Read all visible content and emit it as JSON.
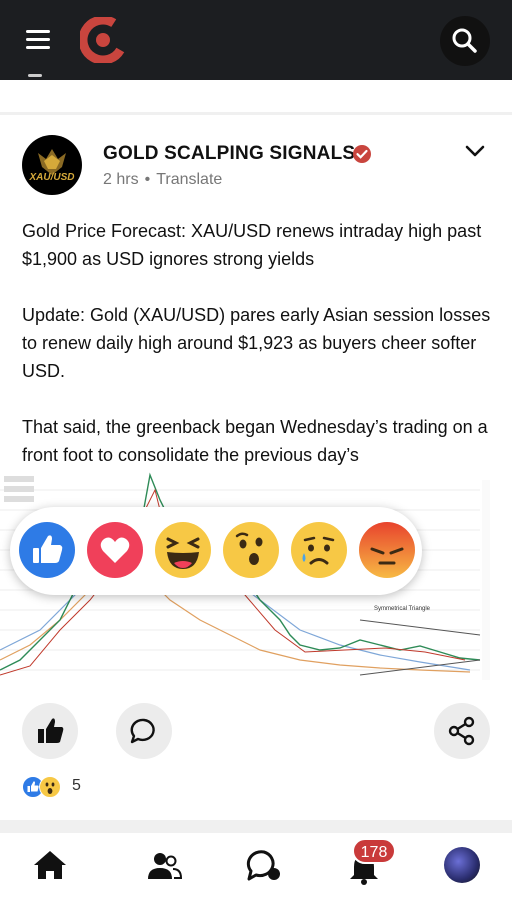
{
  "header": {
    "menu_icon": "hamburger-menu-icon",
    "logo_icon": "app-logo-icon",
    "search_icon": "search-icon",
    "brand_color": "#c9453e"
  },
  "post": {
    "page_name": "GOLD SCALPING SIGNALS",
    "avatar_label": "XAU/USD",
    "verified_icon": "verified-badge-icon",
    "time": "2 hrs",
    "separator": "•",
    "translate": "Translate",
    "menu_icon": "chevron-down-icon",
    "paragraphs": [
      "Gold Price Forecast: XAU/USD renews intraday high past $1,900 as USD ignores strong yields",
      "Update: Gold (XAU/USD) pares early Asian session losses to renew daily high around $1,923 as buyers cheer softer USD.",
      "That said, the greenback began Wednesday’s trading on a front foot to consolidate the previous day’s"
    ],
    "chart_annotation": "Symmetrical Triangle"
  },
  "reactions": {
    "items": [
      "like",
      "love",
      "haha",
      "wow",
      "sad",
      "angry"
    ]
  },
  "actions": {
    "like_icon": "thumbs-up-icon",
    "comment_icon": "comment-icon",
    "share_icon": "share-icon"
  },
  "summary": {
    "icons": [
      "like",
      "wow"
    ],
    "count": "5"
  },
  "bottom_nav": {
    "items": [
      "home-icon",
      "friends-icon",
      "messenger-icon",
      "notifications-icon",
      "profile-avatar"
    ],
    "notification_badge": "178"
  }
}
